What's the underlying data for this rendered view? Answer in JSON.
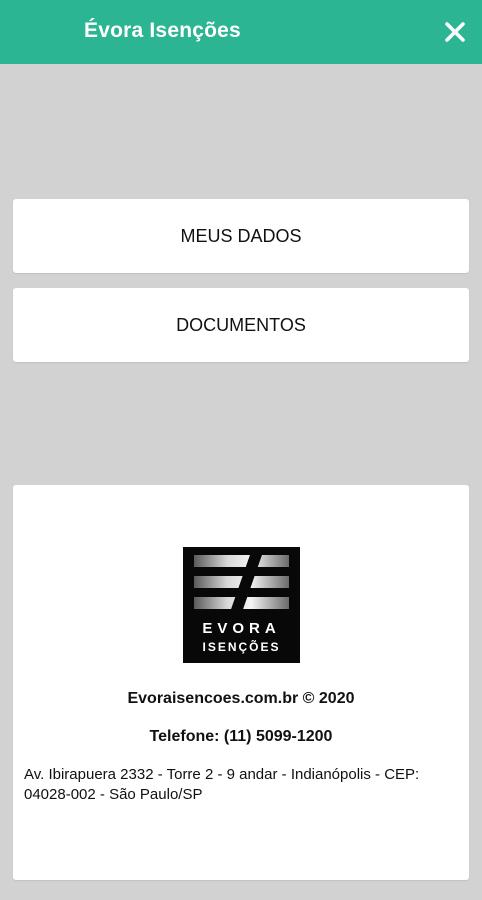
{
  "header": {
    "title": "Évora Isenções",
    "close_icon": "close-icon"
  },
  "menu": {
    "items": [
      {
        "label": "MEUS DADOS"
      },
      {
        "label": "DOCUMENTOS"
      }
    ]
  },
  "footer": {
    "logo_line1": "EVORA",
    "logo_line2": "ISENÇÕES",
    "site": "Evoraisencoes.com.br © 2020",
    "phone": "Telefone: (11) 5099-1200",
    "address": "Av. Ibirapuera 2332 - Torre 2 - 9 andar - Indianópolis - CEP: 04028-002 - São Paulo/SP"
  },
  "colors": {
    "header_bg": "#2bb592",
    "page_bg": "#d2d2d2",
    "card_bg": "#ffffff"
  }
}
